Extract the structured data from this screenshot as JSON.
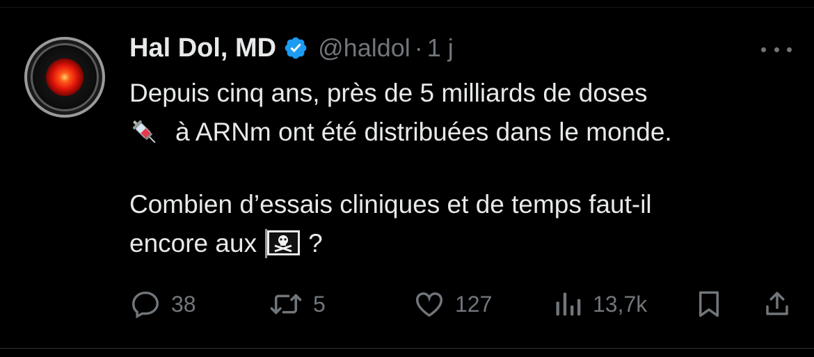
{
  "tweet": {
    "author": {
      "display_name": "Hal Dol, MD",
      "handle": "@haldol",
      "verified": true,
      "avatar_icon": "hal9000-red-eye-avatar"
    },
    "separator": "·",
    "time": "1 j",
    "more_icon": "more-dots-icon",
    "text_lines": [
      "Depuis cinq ans, près de 5 milliards de doses",
      "à ARNm ont été distribuées dans le monde.",
      "Combien d’essais cliniques et de temps faut-il",
      "encore aux",
      "?"
    ],
    "emojis": {
      "syringe": "syringe-emoji",
      "pirate_flag": "pirate-flag-emoji"
    },
    "stats": {
      "replies": "38",
      "retweets": "5",
      "likes": "127",
      "views": "13,7k"
    },
    "colors": {
      "background": "#000000",
      "text": "#e7e9ea",
      "muted": "#71767b",
      "verified_blue": "#1d9bf0"
    }
  }
}
